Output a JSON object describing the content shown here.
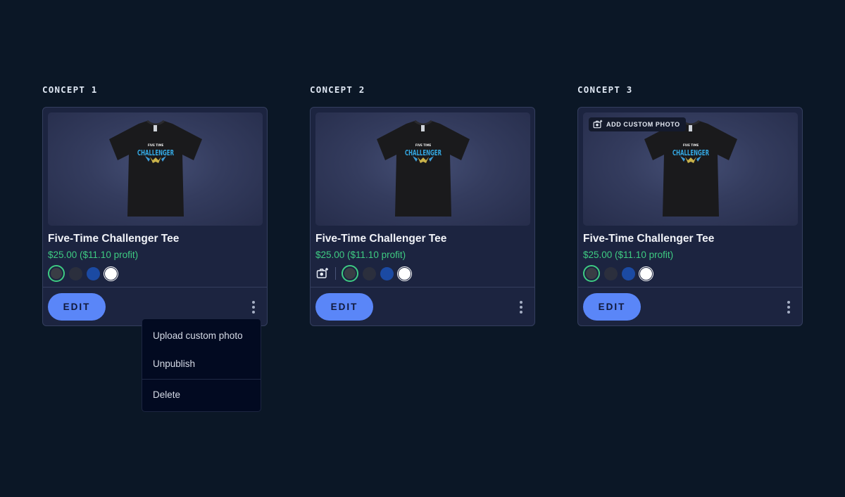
{
  "concepts": [
    {
      "label": "CONCEPT 1",
      "product_title": "Five-Time Challenger Tee",
      "price": "$25.00 ($11.10 profit)",
      "edit_label": "EDIT",
      "has_add_photo_chip": false,
      "has_camera_button": false,
      "swatches": [
        "#3a3d45",
        "#2b2f3d",
        "#1b4aa3",
        "#ffffff"
      ],
      "selected_swatch": 0
    },
    {
      "label": "CONCEPT 2",
      "product_title": "Five-Time Challenger Tee",
      "price": "$25.00 ($11.10 profit)",
      "edit_label": "EDIT",
      "has_add_photo_chip": false,
      "has_camera_button": true,
      "swatches": [
        "#3a3d45",
        "#2b2f3d",
        "#1b4aa3",
        "#ffffff"
      ],
      "selected_swatch": 0
    },
    {
      "label": "CONCEPT 3",
      "product_title": "Five-Time Challenger Tee",
      "price": "$25.00 ($11.10 profit)",
      "edit_label": "EDIT",
      "add_photo_label": "ADD CUSTOM PHOTO",
      "has_add_photo_chip": true,
      "has_camera_button": false,
      "swatches": [
        "#3a3d45",
        "#2b2f3d",
        "#1b4aa3",
        "#ffffff"
      ],
      "selected_swatch": 0
    }
  ],
  "tee_graphic": {
    "top_text": "FIVE TIME",
    "main_text": "CHALLENGER"
  },
  "context_menu": {
    "items": [
      "Upload custom photo",
      "Unpublish",
      "Delete"
    ]
  },
  "colors": {
    "background": "#0b1726",
    "card": "#1c2440",
    "accent": "#5a86f8",
    "price": "#3ecb82"
  }
}
